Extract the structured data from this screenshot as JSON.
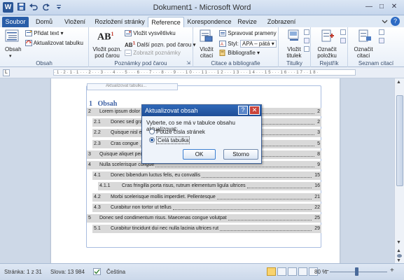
{
  "window": {
    "title": "Dokument1 - Microsoft Word",
    "app_icon": "W"
  },
  "qat": [
    "save-icon",
    "undo-icon",
    "redo-icon",
    "customize-icon"
  ],
  "tabs": [
    {
      "label": "Soubor"
    },
    {
      "label": "Domů"
    },
    {
      "label": "Vložení"
    },
    {
      "label": "Rozložení stránky"
    },
    {
      "label": "Reference"
    },
    {
      "label": "Korespondence"
    },
    {
      "label": "Revize"
    },
    {
      "label": "Zobrazení"
    }
  ],
  "active_tab": "Reference",
  "ribbon": {
    "obsah": {
      "group": "Obsah",
      "big": "Obsah",
      "add_text": "Přidat text",
      "update_table": "Aktualizovat tabulku"
    },
    "footnotes": {
      "group": "Poznámky pod čarou",
      "insert_line1": "Vložit pozn.",
      "insert_line2": "pod čarou",
      "insert_endnote": "Vložit vysvětlivku",
      "next_note": "Další pozn. pod čarou",
      "show_notes": "Zobrazit poznámky"
    },
    "citations": {
      "group": "Citace a bibliografie",
      "insert_line1": "Vložit",
      "insert_line2": "citaci",
      "manage": "Spravovat prameny",
      "style_label": "Styl:",
      "style_value": "APA – pátá",
      "bibliography": "Bibliografie"
    },
    "captions": {
      "group": "Titulky",
      "line1": "Vložit",
      "line2": "titulek"
    },
    "index": {
      "group": "Rejstřík",
      "line1": "Označit",
      "line2": "položku"
    },
    "authorities": {
      "group": "Seznam citací",
      "line1": "Označit",
      "line2": "citaci"
    }
  },
  "document": {
    "toc_heading": "Obsah",
    "toc_heading_num": "1",
    "toc_tab_text": "Aktualizovat tabulku...",
    "entries": [
      {
        "num": "2",
        "text": "Lorem ipsum dolor sit amet, consectetuer adipiscing elit",
        "page": "2",
        "level": 1
      },
      {
        "num": "2.1",
        "text": "Donec sed gravida",
        "page": "2",
        "level": 2
      },
      {
        "num": "2.2",
        "text": "Quisque nisl elit",
        "page": "3",
        "level": 2
      },
      {
        "num": "2.3",
        "text": "Cras congue",
        "page": "5",
        "level": 2
      },
      {
        "num": "3",
        "text": "Quisque aliquet pede",
        "page": "8",
        "level": 1
      },
      {
        "num": "4",
        "text": "Nulla scelerisque congue",
        "page": "9",
        "level": 1
      },
      {
        "num": "4.1",
        "text": "Donec bibendum luctus felis, eu convallis",
        "page": "15",
        "level": 2
      },
      {
        "num": "4.1.1",
        "text": "Cras fringilla porta risus, rutrum elementum ligula ultrices",
        "page": "16",
        "level": 3
      },
      {
        "num": "4.2",
        "text": "Morbi scelerisque mollis imperdiet. Pellentesque",
        "page": "21",
        "level": 2
      },
      {
        "num": "4.3",
        "text": "Curabitur non tortor ut tellus",
        "page": "22",
        "level": 2
      },
      {
        "num": "5",
        "text": "Donec sed condimentum risus. Maecenas congue volutpat",
        "page": "25",
        "level": 1
      },
      {
        "num": "5.1",
        "text": "Curabitur tincidunt dui nec nulla lacinia ultrices rut",
        "page": "29",
        "level": 2
      }
    ]
  },
  "dialog": {
    "title": "Aktualizovat obsah",
    "prompt": "Vyberte, co se má v tabulce obsahu aktualizovat:",
    "option1": "Pouze čísla stránek",
    "option2": "Celá tabulka",
    "selected": "option2",
    "ok": "OK",
    "cancel": "Storno"
  },
  "statusbar": {
    "page": "Stránka: 1 z 31",
    "words": "Slova: 13 984",
    "language": "Čeština",
    "zoom": "80 %",
    "zoom_level": 0.46
  },
  "colors": {
    "accent": "#2a5ea8",
    "toc_heading": "#3f62a5",
    "highlight": "#d9d9d9"
  }
}
